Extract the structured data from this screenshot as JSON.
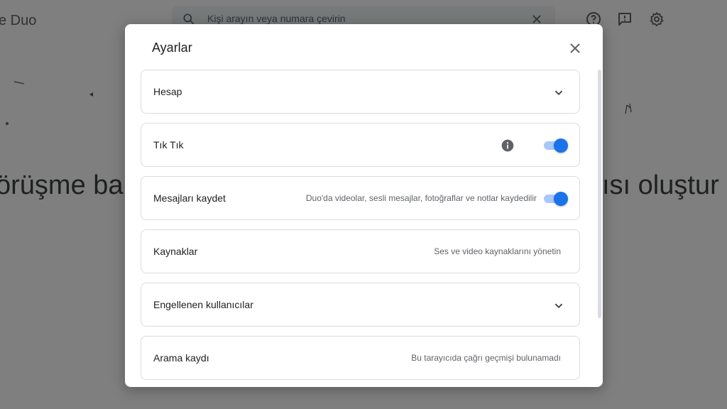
{
  "app": {
    "title": "e Duo",
    "search_placeholder": "Kişi arayın veya numara çevirin",
    "bg_heading_left": "örüşme ba",
    "bg_heading_right": "ısı oluştur"
  },
  "dialog": {
    "title": "Ayarlar",
    "rows": [
      {
        "label": "Hesap",
        "kind": "expand"
      },
      {
        "label": "Tık Tık",
        "kind": "toggle",
        "toggle_on": true
      },
      {
        "label": "Mesajları kaydet",
        "desc": "Duo'da videolar, sesli mesajlar, fotoğraflar ve notlar kaydedilir",
        "kind": "toggle",
        "toggle_on": true
      },
      {
        "label": "Kaynaklar",
        "desc": "Ses ve video kaynaklarını yönetin",
        "kind": "link"
      },
      {
        "label": "Engellenen kullanıcılar",
        "kind": "expand"
      },
      {
        "label": "Arama kaydı",
        "desc": "Bu tarayıcıda çağrı geçmişi bulunamadı",
        "kind": "info"
      }
    ]
  },
  "colors": {
    "accent": "#1a73e8",
    "toggle_track": "#a8c7fa",
    "border": "#dadce0",
    "overlay": "rgba(0,0,0,0.5)"
  },
  "icons": {
    "search": "search-icon",
    "clear": "close-icon",
    "help": "help-icon",
    "feedback": "feedback-icon",
    "settings": "gear-icon",
    "dialog_close": "close-icon",
    "expand": "chevron-down-icon",
    "info": "info-icon"
  }
}
